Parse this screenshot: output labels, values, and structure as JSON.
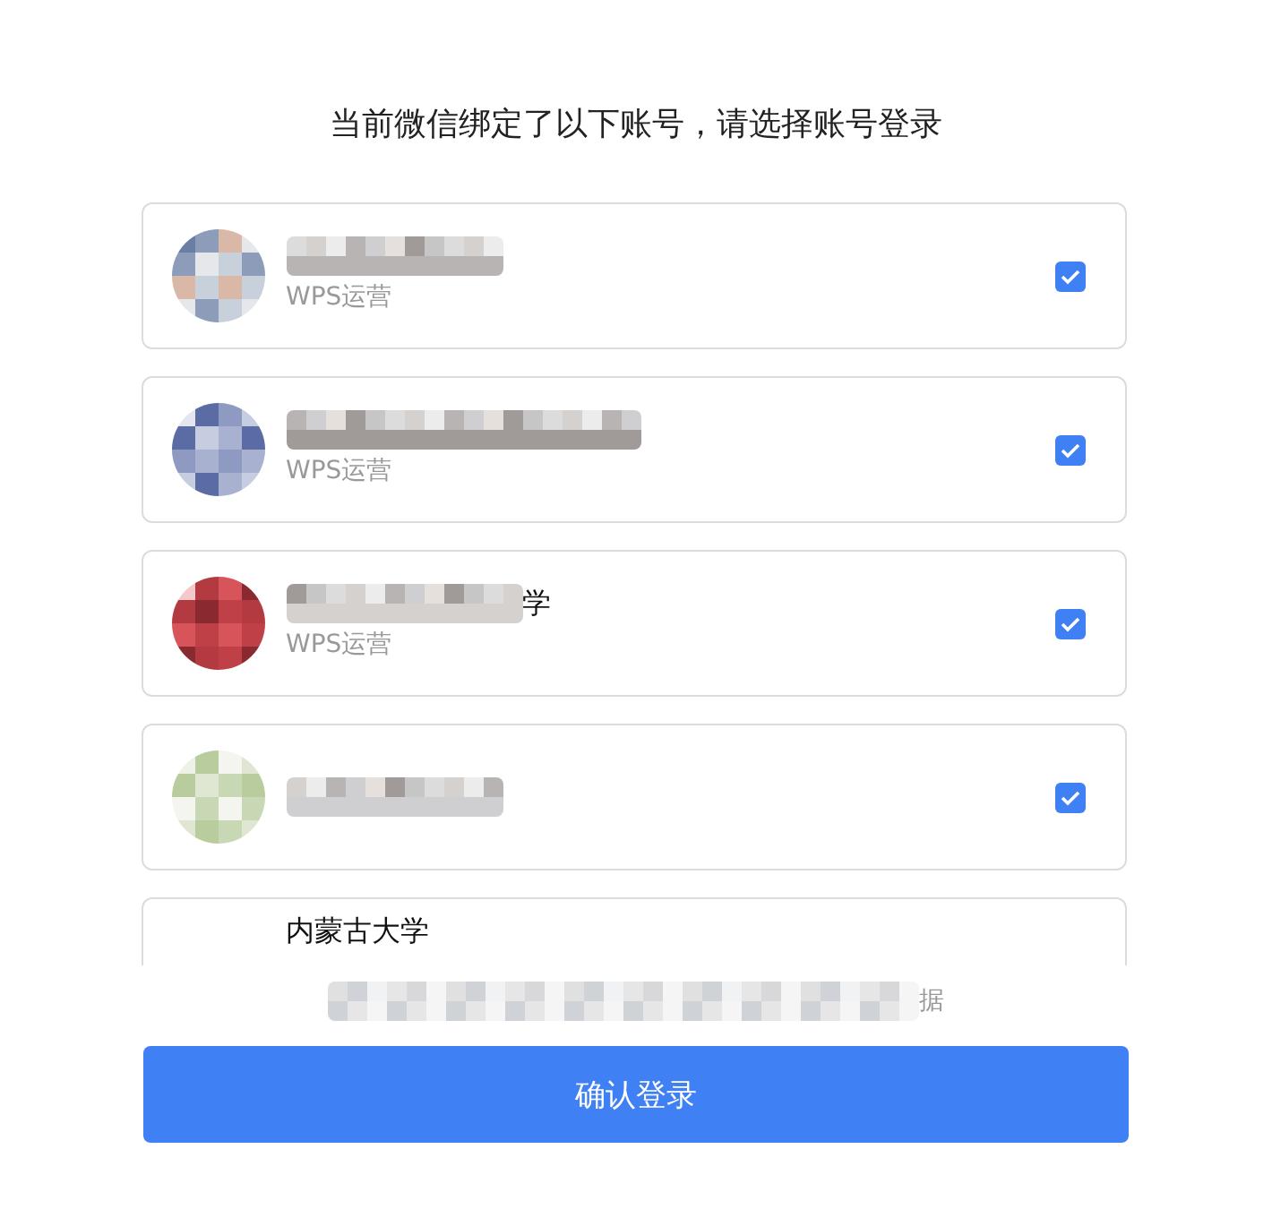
{
  "title": "当前微信绑定了以下账号，请选择账号登录",
  "accounts": [
    {
      "org": "WPS运营",
      "checked": true
    },
    {
      "org": "WPS运营",
      "checked": true
    },
    {
      "name_tail": "学",
      "org": "WPS运营",
      "checked": true
    },
    {
      "checked": true
    },
    {
      "name": "内蒙古大学"
    }
  ],
  "note_tail": "据",
  "confirm_button": "确认登录"
}
